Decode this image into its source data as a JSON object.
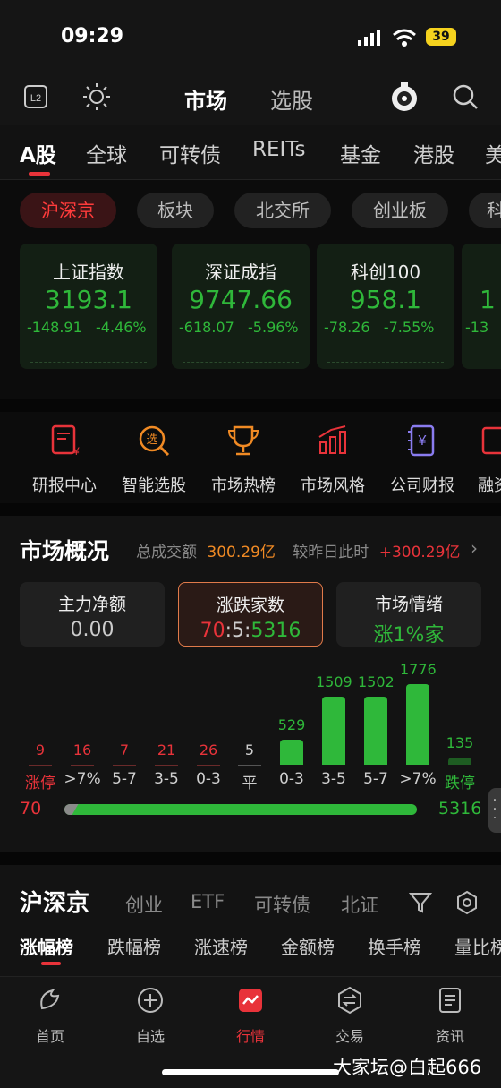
{
  "status": {
    "time": "09:29",
    "battery": "39"
  },
  "header": {
    "title": "市场",
    "title2": "选股"
  },
  "tabs": [
    "A股",
    "全球",
    "可转债",
    "REITs",
    "基金",
    "港股",
    "美"
  ],
  "chips": [
    "沪深京",
    "板块",
    "北交所",
    "创业板",
    "科"
  ],
  "indices": [
    {
      "name": "上证指数",
      "price": "3193.1",
      "change": "-148.91",
      "pct": "-4.46%"
    },
    {
      "name": "深证成指",
      "price": "9747.66",
      "change": "-618.07",
      "pct": "-5.96%"
    },
    {
      "name": "科创100",
      "price": "958.1",
      "change": "-78.26",
      "pct": "-7.55%"
    },
    {
      "name": "",
      "price": "1",
      "change": "-13",
      "pct": ""
    }
  ],
  "quick": [
    "研报中心",
    "智能选股",
    "市场热榜",
    "市场风格",
    "公司财报",
    "融资"
  ],
  "overview": {
    "title": "市场概况",
    "turnover_label": "总成交额",
    "turnover": "300.29亿",
    "compare_label": "较昨日此时",
    "compare": "+300.29亿"
  },
  "boxes": {
    "b1_title": "主力净额",
    "b1_value": "0.00",
    "b2_title": "涨跌家数",
    "b2_up": "70",
    "b2_flat": "5",
    "b2_down": "5316",
    "b3_title": "市场情绪",
    "b3_value": "涨1%家"
  },
  "chart_data": {
    "type": "bar",
    "categories": [
      "涨停",
      ">7%",
      "5-7",
      "3-5",
      "0-3",
      "平",
      "0-3",
      "3-5",
      "5-7",
      ">7%",
      "跌停"
    ],
    "values": [
      9,
      16,
      7,
      21,
      26,
      5,
      529,
      1509,
      1502,
      1776,
      135
    ]
  },
  "ratio": {
    "up": "70",
    "down": "5316",
    "up_share": 0.013
  },
  "list": {
    "title": "沪深京",
    "tabs": [
      "创业",
      "ETF",
      "可转债",
      "北证"
    ],
    "rank_tabs": [
      "涨幅榜",
      "跌幅榜",
      "涨速榜",
      "金额榜",
      "换手榜",
      "量比榜"
    ]
  },
  "nav": [
    "首页",
    "自选",
    "行情",
    "交易",
    "资讯"
  ],
  "watermark": "大家坛@白起666"
}
